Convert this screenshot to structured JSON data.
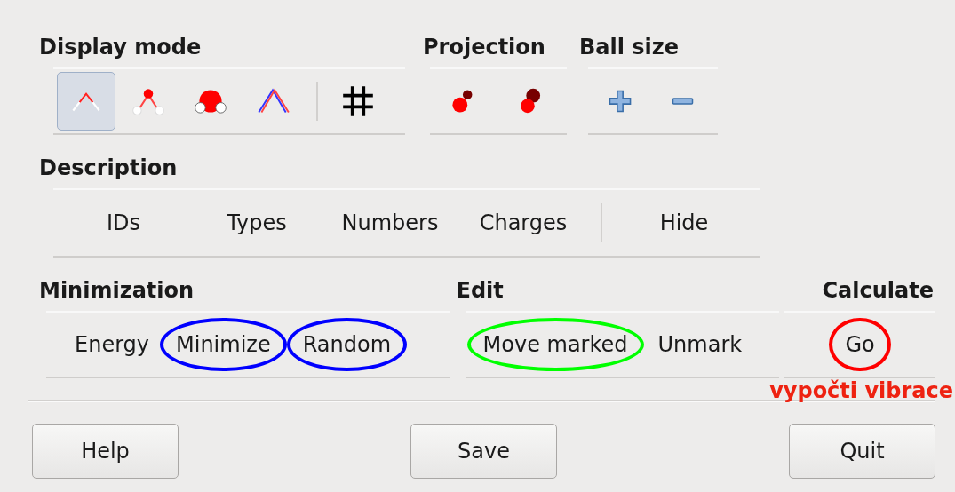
{
  "display_mode": {
    "title": "Display mode",
    "modes": [
      {
        "kind": "lines",
        "selected": true
      },
      {
        "kind": "ball_stick",
        "selected": false
      },
      {
        "kind": "spacefill",
        "selected": false
      },
      {
        "kind": "stereo",
        "selected": false
      }
    ],
    "extra": [
      {
        "kind": "grid"
      }
    ]
  },
  "projection": {
    "title": "Projection",
    "items": [
      {
        "kind": "small_back"
      },
      {
        "kind": "large_back"
      }
    ]
  },
  "ball_size": {
    "title": "Ball size",
    "items": [
      {
        "kind": "increase"
      },
      {
        "kind": "decrease"
      }
    ]
  },
  "description": {
    "title": "Description",
    "buttons": [
      {
        "label": "IDs"
      },
      {
        "label": "Types"
      },
      {
        "label": "Numbers"
      },
      {
        "label": "Charges"
      }
    ],
    "extra": [
      {
        "label": "Hide"
      }
    ]
  },
  "minimization": {
    "title": "Minimization",
    "buttons": [
      {
        "label": "Energy"
      },
      {
        "label": "Minimize",
        "color": "#0000ff"
      },
      {
        "label": "Random",
        "color": "#0000ff"
      }
    ]
  },
  "edit": {
    "title": "Edit",
    "buttons": [
      {
        "label": "Move marked",
        "color": "#00ff00"
      },
      {
        "label": "Unmark"
      }
    ]
  },
  "calculate": {
    "title": "Calculate",
    "buttons": [
      {
        "label": "Go",
        "color": "#ff0000"
      }
    ],
    "note": "vypočti vibrace"
  },
  "footer_buttons": [
    "Help",
    "Save",
    "Quit"
  ]
}
